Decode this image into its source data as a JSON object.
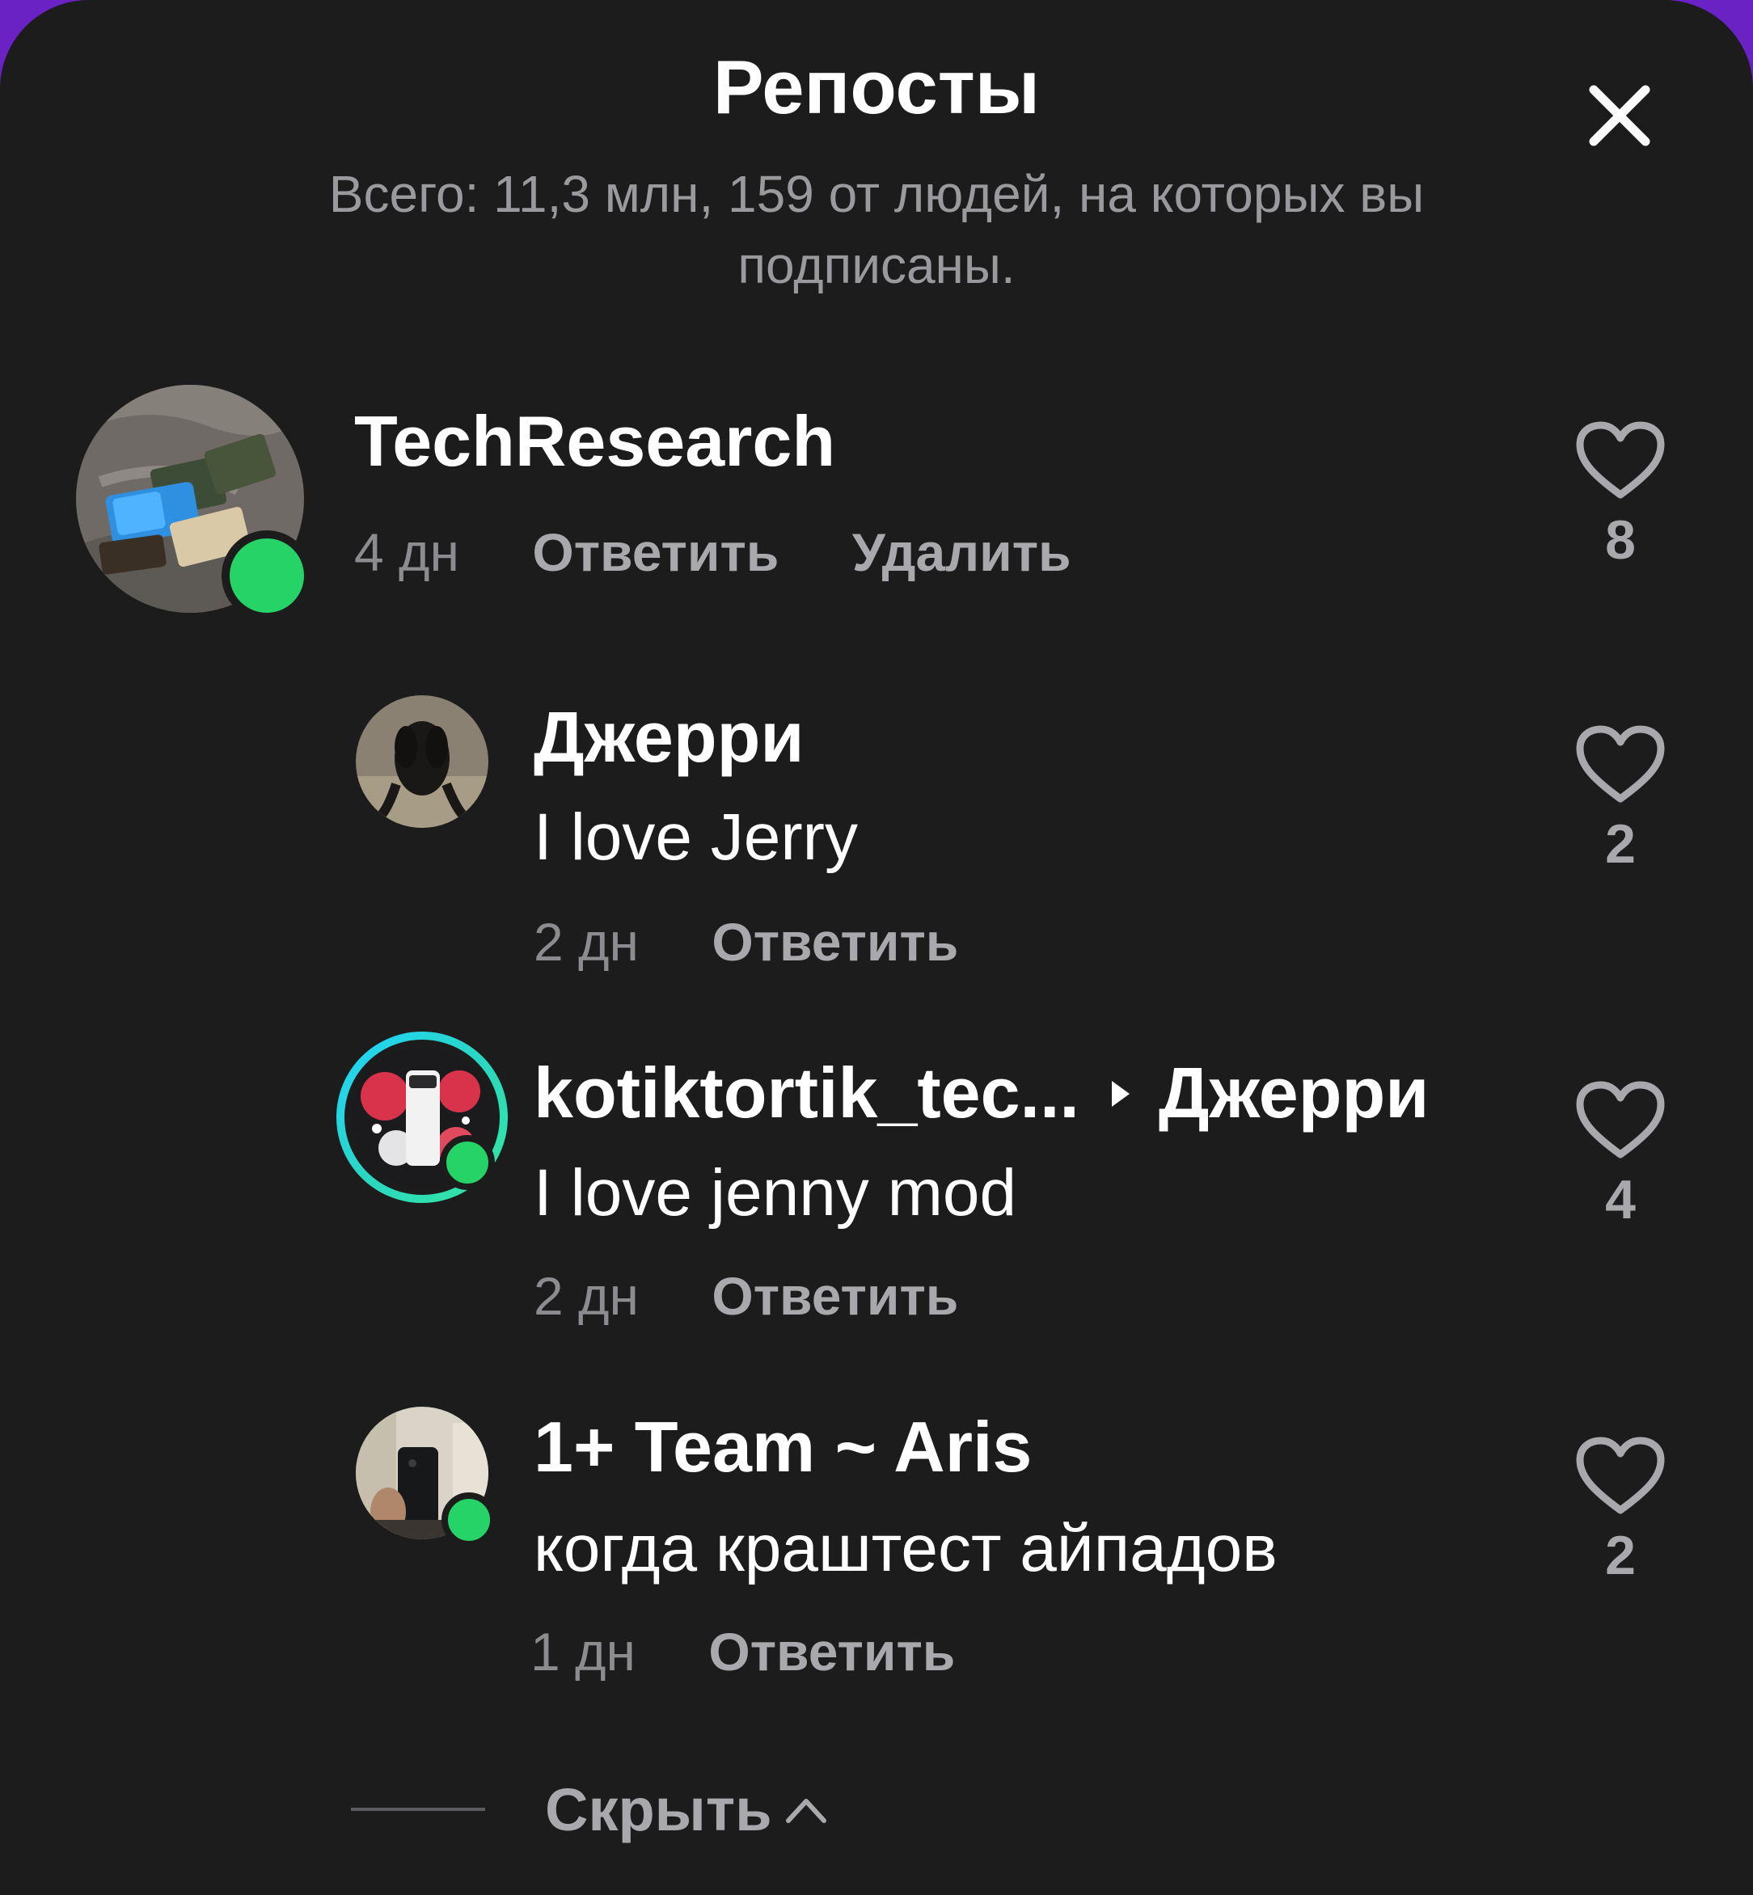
{
  "header": {
    "title": "Репосты",
    "subtitle": "Всего: 11,3 млн, 159 от людей, на которых вы подписаны."
  },
  "comments": [
    {
      "name": "TechResearch",
      "time": "4 дн",
      "actions": [
        "Ответить",
        "Удалить"
      ],
      "likes": "8",
      "online": true
    },
    {
      "name": "Джерри",
      "text": "I love Jerry",
      "time": "2 дн",
      "actions": [
        "Ответить"
      ],
      "likes": "2",
      "online": false
    },
    {
      "name": "kotiktortik_tec...",
      "reply_to": "Джерри",
      "text": "I love jenny mod",
      "time": "2 дн",
      "actions": [
        "Ответить"
      ],
      "likes": "4",
      "online": true,
      "story_ring": true
    },
    {
      "name": "1+ Team ~ Aris",
      "text": "когда краштест айпадов",
      "time": "1 дн",
      "actions": [
        "Ответить"
      ],
      "likes": "2",
      "online": true
    }
  ],
  "footer": {
    "hide_label": "Скрыть"
  },
  "colors": {
    "background": "#1c1c1d",
    "online": "#25d366",
    "muted_text": "#a9a9ad",
    "story_ring_start": "#21d4fd",
    "story_ring_end": "#34e89e"
  }
}
